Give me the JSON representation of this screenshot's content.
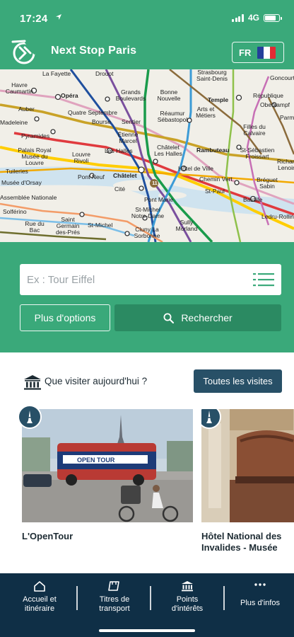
{
  "status": {
    "time": "17:24",
    "network": "4G",
    "battery_level": 0.8
  },
  "app": {
    "title": "Next Stop Paris",
    "language": "FR"
  },
  "colors": {
    "brand_green": "#3aa97a",
    "dark_green": "#2b8a62",
    "navy": "#285067",
    "tabbar": "#0f2f46"
  },
  "map": {
    "stations": [
      "Havre Caumartin",
      "Opéra",
      "Grands Boulevards",
      "Bonne Nouvelle",
      "Temple",
      "République",
      "Oberkampf",
      "Parmentier",
      "Auber",
      "Quatre Septembre",
      "Bourse",
      "Sentier",
      "Réaumur Sébastopol",
      "Arts et Métiers",
      "Filles du Calvaire",
      "Pyramides",
      "Étienne Marcel",
      "Palais Royal Musée du Louvre",
      "Louvre Rivoli",
      "Les Halles",
      "Châtelet Les Halles",
      "Rambuteau",
      "St-Sébastien Froissart",
      "Richard Lenoir",
      "Tuileries",
      "Pont Neuf",
      "Châtelet",
      "Hôtel de Ville",
      "Chemin Vert",
      "Bréguet Sabin",
      "Musée d'Orsay",
      "Cité",
      "St-Paul",
      "Bastille",
      "Assemblée Nationale",
      "Pont Marie",
      "Solférino",
      "St-Michel Notre-Dame",
      "Sully Morland",
      "Ledru-Rollin",
      "Rue du Bac",
      "Saint Germain des-Prés",
      "St-Michel",
      "Cluny La Sorbonne",
      "La Fayette",
      "Drouot",
      "Strasbourg Saint-Denis",
      "Goncourt",
      "Madeleine"
    ],
    "line_badge": "11"
  },
  "search": {
    "placeholder": "Ex : Tour Eiffel",
    "options_label": "Plus d'options",
    "search_label": "Rechercher"
  },
  "visits": {
    "title": "Que visiter aujourd'hui ?",
    "all_label": "Toutes les visites",
    "cards": [
      {
        "name": "L'OpenTour",
        "bus_text": "OPEN TOUR"
      },
      {
        "name": "Hôtel National des Invalides - Musée"
      }
    ]
  },
  "tabs": [
    {
      "label": "Accueil et itinéraire",
      "icon": "home-icon"
    },
    {
      "label": "Titres de transport",
      "icon": "ticket-icon"
    },
    {
      "label": "Points d'intérêts",
      "icon": "monument-icon"
    },
    {
      "label": "Plus d'infos",
      "icon": "more-icon"
    }
  ]
}
